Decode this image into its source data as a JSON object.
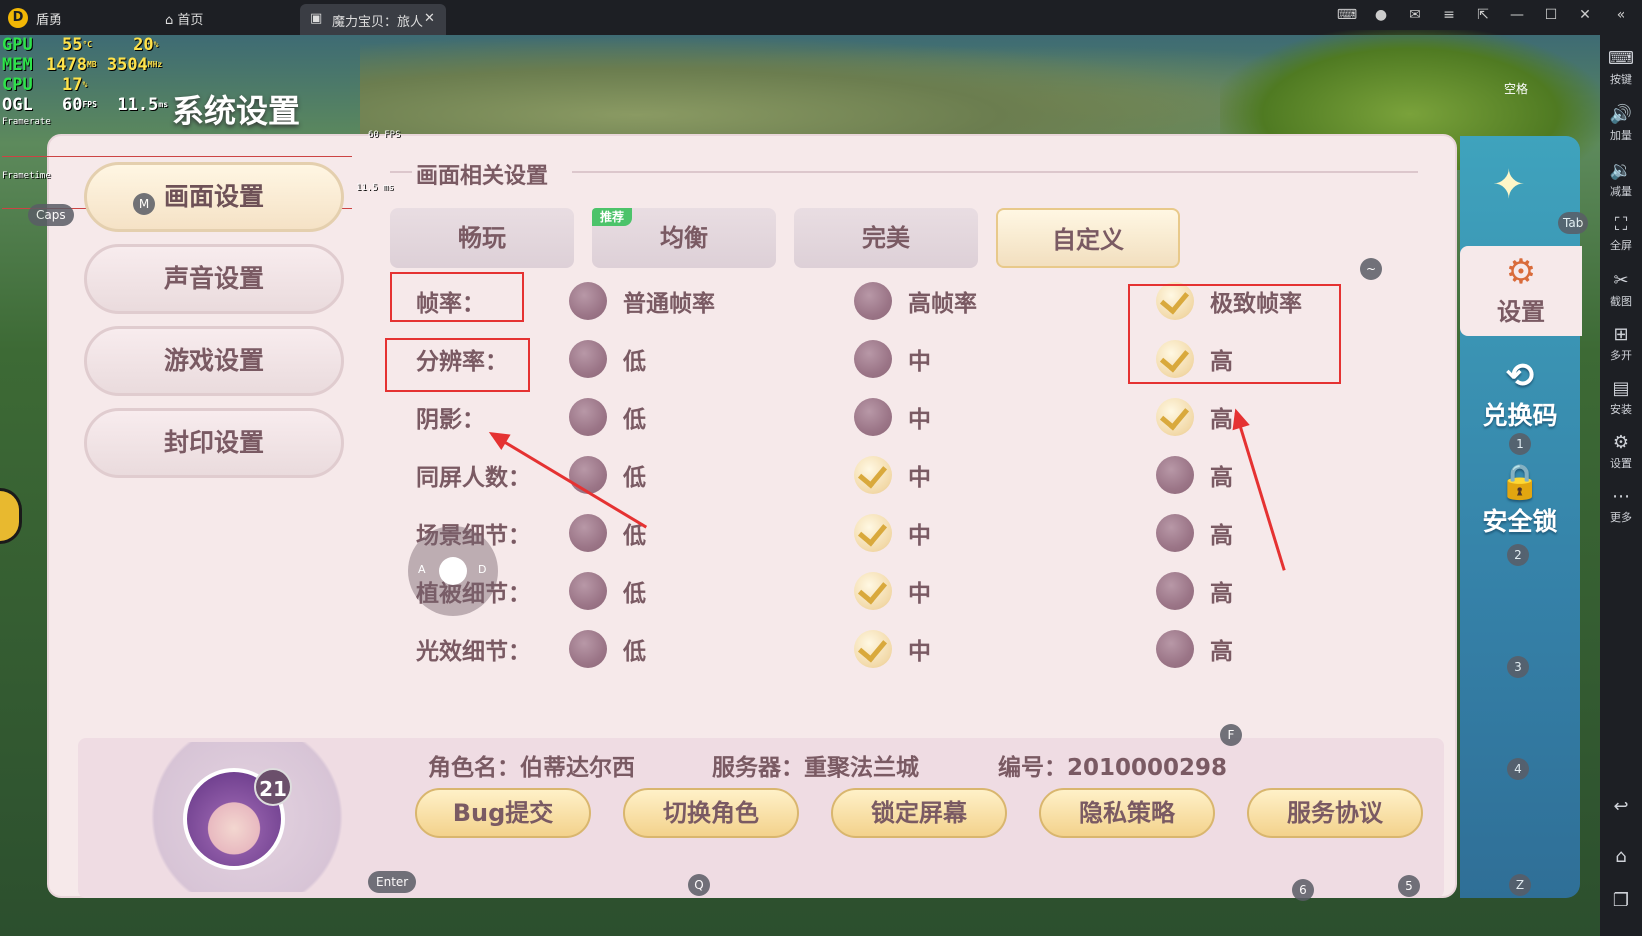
{
  "window": {
    "app_name": "盾勇",
    "home_tab": "首页",
    "game_tab": "魔力宝贝：旅人"
  },
  "perf": {
    "gpu_label": "GPU",
    "gpu_temp": "55",
    "gpu_temp_unit": "°C",
    "gpu_load": "20",
    "gpu_load_unit": "%",
    "mem_label": "MEM",
    "mem_used": "1478",
    "mem_unit": "MB",
    "mem_clock": "3504",
    "mem_clock_unit": "MHz",
    "cpu_label": "CPU",
    "cpu_load": "17",
    "cpu_load_unit": "%",
    "ogl_label": "OGL",
    "fps": "60",
    "fps_unit": "FPS",
    "frametime": "11.5",
    "frametime_unit": "ms",
    "framerate_label": "Framerate",
    "framerate_value": "60 FPS",
    "frametime_label": "Frametime",
    "frametime_value": "11.5 ms"
  },
  "page_title": "系统设置",
  "nav": {
    "items": [
      {
        "label": "画面设置",
        "active": true
      },
      {
        "label": "声音设置",
        "active": false
      },
      {
        "label": "游戏设置",
        "active": false
      },
      {
        "label": "封印设置",
        "active": false
      }
    ],
    "hotkey": "M"
  },
  "section_title": "画面相关设置",
  "presets": {
    "items": [
      "畅玩",
      "均衡",
      "完美",
      "自定义"
    ],
    "recommended_badge": "推荐",
    "active": "自定义"
  },
  "settings": [
    {
      "label": "帧率：",
      "options": [
        "普通帧率",
        "高帧率",
        "极致帧率"
      ],
      "selected": 2
    },
    {
      "label": "分辨率：",
      "options": [
        "低",
        "中",
        "高"
      ],
      "selected": 2
    },
    {
      "label": "阴影：",
      "options": [
        "低",
        "中",
        "高"
      ],
      "selected": 2
    },
    {
      "label": "同屏人数：",
      "options": [
        "低",
        "中",
        "高"
      ],
      "selected": 1
    },
    {
      "label": "场景细节：",
      "options": [
        "低",
        "中",
        "高"
      ],
      "selected": 1
    },
    {
      "label": "植被细节：",
      "options": [
        "低",
        "中",
        "高"
      ],
      "selected": 1
    },
    {
      "label": "光效细节：",
      "options": [
        "低",
        "中",
        "高"
      ],
      "selected": 1
    }
  ],
  "profile": {
    "level": "21",
    "name_text": "角色名：伯蒂达尔西",
    "server_text": "服务器：重聚法兰城",
    "id_text": "编号：2010000298"
  },
  "actions": [
    "Bug提交",
    "切换角色",
    "锁定屏幕",
    "隐私策略",
    "服务协议"
  ],
  "game_menu": {
    "settings": "设置",
    "redeem": "兑换码",
    "lock": "安全锁"
  },
  "key_hints": {
    "space": "空格",
    "tab": "Tab",
    "caps": "Caps",
    "tilde": "~",
    "f": "F",
    "enter": "Enter",
    "q": "Q",
    "a": "A",
    "d": "D",
    "n1": "1",
    "n2": "2",
    "n3": "3",
    "n4": "4",
    "n5": "5",
    "n6": "6",
    "z": "Z"
  },
  "emulator_sidebar": {
    "keymap": "按键",
    "vol_up": "加量",
    "vol_down": "减量",
    "fullscreen": "全屏",
    "screenshot": "截图",
    "multi": "多开",
    "install": "安装",
    "settings": "设置",
    "more": "更多"
  },
  "colors": {
    "highlight_box": "#e53232",
    "accent_gold": "#d9a93c",
    "check_green": "#4cc36a"
  }
}
